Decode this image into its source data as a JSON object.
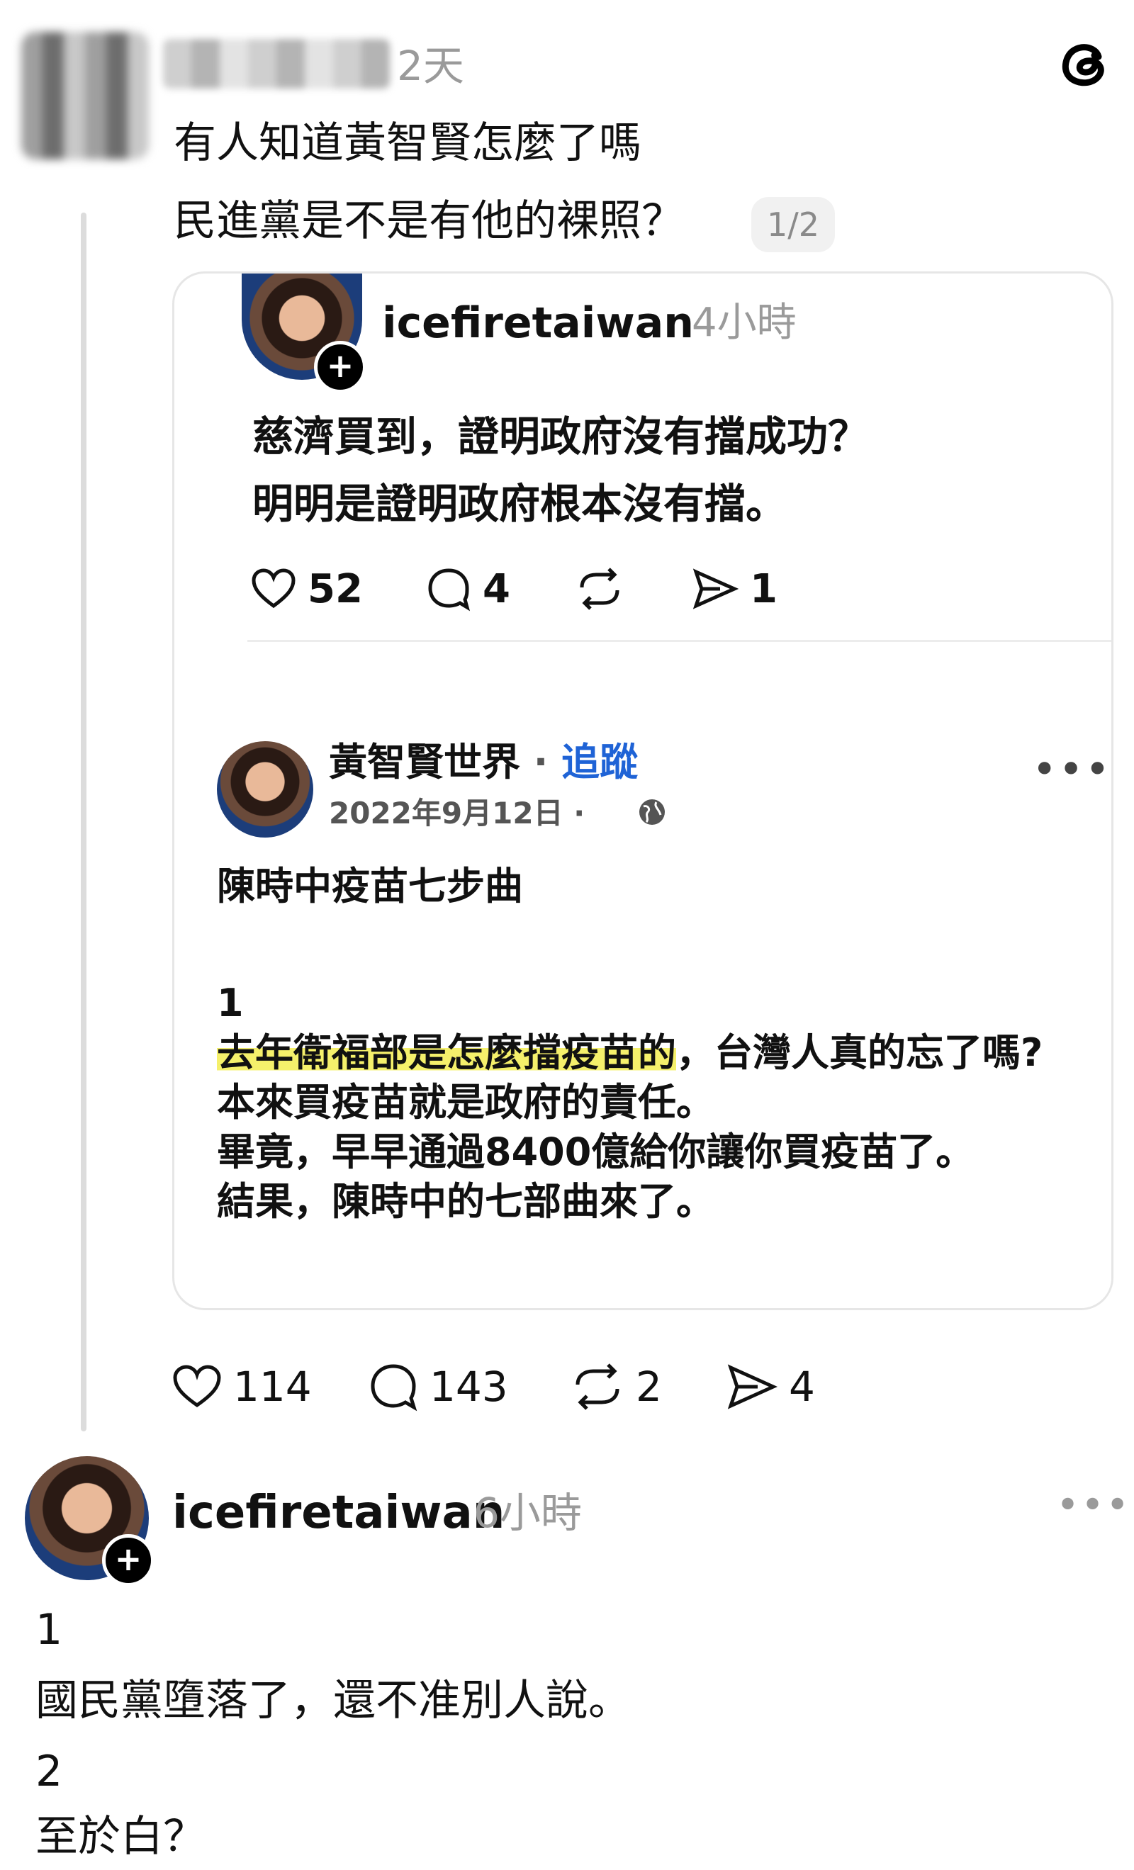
{
  "post1": {
    "time": "2天",
    "lines": [
      "有人知道黃智賢怎麼了嗎",
      "民進黨是不是有他的裸照？"
    ],
    "page_indicator": "1/2"
  },
  "quoted": {
    "username": "icefiretaiwan",
    "time": "4小時",
    "lines": [
      "慈濟買到，證明政府沒有擋成功？",
      "明明是證明政府根本沒有擋。"
    ],
    "likes": "52",
    "replies": "4",
    "shares": "1"
  },
  "fb": {
    "name": "黃智賢世界",
    "dot": " · ",
    "follow": "追蹤",
    "date": "2022年9月12日 ·",
    "title": "陳時中疫苗七步曲",
    "number": "1",
    "highlight": "去年衛福部是怎麼擋疫苗的",
    "line1_rest": "，台灣人真的忘了嗎?",
    "line2": "本來買疫苗就是政府的責任。",
    "line3": "畢竟，早早通過8400億給你讓你買疫苗了。",
    "line4": "結果，陳時中的七部曲來了。"
  },
  "post1_stats": {
    "likes": "114",
    "replies": "143",
    "reposts": "2",
    "shares": "4"
  },
  "post2": {
    "username": "icefiretaiwan",
    "time": "6小時",
    "lines": [
      "1",
      "國民黨墮落了，還不准別人說。",
      "2",
      "至於白？"
    ]
  },
  "icons": {
    "app_logo": "threads-logo-icon",
    "like": "heart-icon",
    "reply": "comment-bubble-icon",
    "repost": "repost-icon",
    "share": "send-icon",
    "more": "more-icon",
    "globe": "globe-icon"
  },
  "colors": {
    "follow": "#1f63d6",
    "highlight": "#f5f06b",
    "muted": "#9a9a9a"
  }
}
